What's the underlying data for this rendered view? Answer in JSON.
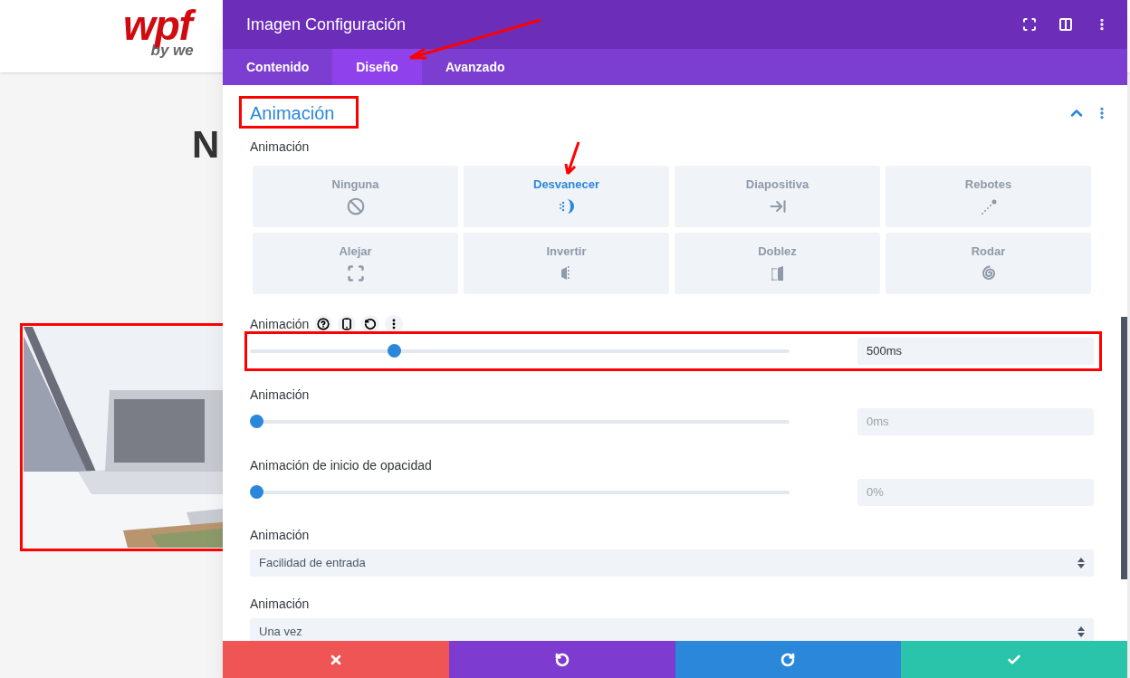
{
  "page": {
    "logo": {
      "main": "wpf",
      "sub": "by we"
    },
    "heading": "N",
    "picture": {
      "kind": "picture",
      "highlighted": true
    }
  },
  "panel": {
    "title": "Imagen Configuración",
    "tabs": [
      {
        "label": "Contenido",
        "selected": false,
        "pointed": false
      },
      {
        "label": "Diseño",
        "selected": true,
        "pointed": true
      },
      {
        "label": "Avanzado",
        "selected": false,
        "pointed": false
      }
    ],
    "section": {
      "title": "Animación",
      "expanded": true,
      "highlighted": true
    },
    "style_label": "Animación",
    "styles": [
      {
        "label": "Ninguna",
        "kind": "none",
        "selected": false,
        "pointed": false
      },
      {
        "label": "Desvanecer",
        "kind": "fade",
        "selected": true,
        "pointed": true
      },
      {
        "label": "Diapositiva",
        "kind": "slide",
        "selected": false,
        "pointed": false
      },
      {
        "label": "Rebotes",
        "kind": "bounce",
        "selected": false,
        "pointed": false
      },
      {
        "label": "Alejar",
        "kind": "zoom",
        "selected": false,
        "pointed": false
      },
      {
        "label": "Invertir",
        "kind": "flip",
        "selected": false,
        "pointed": false
      },
      {
        "label": "Doblez",
        "kind": "fold",
        "selected": false,
        "pointed": false
      },
      {
        "label": "Rodar",
        "kind": "roll",
        "selected": false,
        "pointed": false
      }
    ],
    "sliders": [
      {
        "label": "Animación",
        "tools": true,
        "level": 0.255,
        "value": "500ms",
        "highlighted": true
      },
      {
        "label": "Animación",
        "tools": false,
        "level": 0,
        "value": "0ms",
        "highlighted": false
      },
      {
        "label": "Animación de inicio de opacidad",
        "tools": false,
        "level": 0,
        "value": "0%",
        "highlighted": false
      }
    ],
    "selects": [
      {
        "label": "Animación",
        "value": "Facilidad de entrada"
      },
      {
        "label": "Animación",
        "value": "Una vez"
      }
    ],
    "footer": [
      {
        "kind": "cancel"
      },
      {
        "kind": "undo"
      },
      {
        "kind": "redo"
      },
      {
        "kind": "save"
      }
    ]
  }
}
